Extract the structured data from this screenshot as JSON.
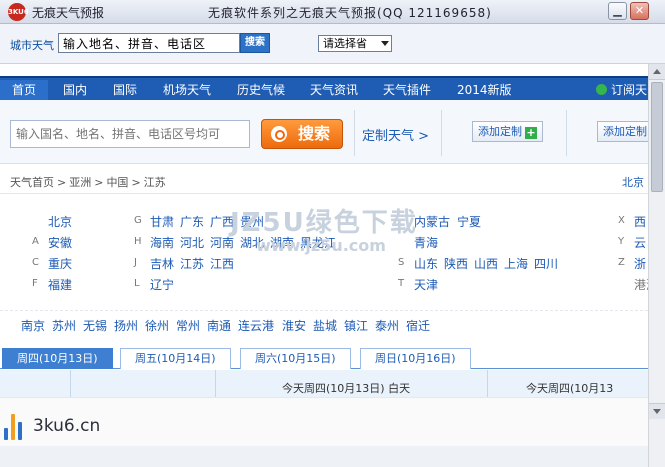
{
  "titlebar": {
    "logo_text": "3KU6",
    "app_name": "无痕天气预报",
    "window_title": "无痕软件系列之无痕天气预报(QQ 121169658)",
    "minimize": "▁",
    "close": "✕"
  },
  "toolbar": {
    "city_label": "城市天气",
    "input_value": "输入地名、拼音、电话区",
    "search_label": "搜索",
    "select_value": "请选择省"
  },
  "nav": {
    "items": [
      "首页",
      "国内",
      "国际",
      "机场天气",
      "历史气候",
      "天气资讯",
      "天气插件",
      "2014新版"
    ],
    "subscribe": "订阅天"
  },
  "site_search": {
    "placeholder": "输入国名、地名、拼音、电话区号均可",
    "button": "搜索",
    "custom_weather": "定制天气 >",
    "add_custom_1": "添加定制",
    "add_custom_2": "添加定制"
  },
  "breadcrumb": {
    "items": [
      "天气首页",
      "亚洲",
      "中国",
      "江苏"
    ],
    "separator": ">",
    "right": "北京"
  },
  "provinces": {
    "col1": [
      {
        "letter": "",
        "names": [
          "北京"
        ]
      },
      {
        "letter": "A",
        "names": [
          "安徽"
        ]
      },
      {
        "letter": "C",
        "names": [
          "重庆"
        ]
      },
      {
        "letter": "F",
        "names": [
          "福建"
        ]
      }
    ],
    "col2": [
      {
        "letter": "G",
        "names": [
          "甘肃",
          "广东",
          "广西",
          "贵州"
        ]
      },
      {
        "letter": "H",
        "names": [
          "海南",
          "河北",
          "河南",
          "湖北",
          "湖南",
          "黑龙江"
        ]
      },
      {
        "letter": "J",
        "names": [
          "吉林",
          "江苏",
          "江西"
        ]
      },
      {
        "letter": "L",
        "names": [
          "辽宁"
        ]
      }
    ],
    "col3": [
      {
        "letter": "",
        "names": [
          "内蒙古",
          "宁夏"
        ]
      },
      {
        "letter": "",
        "names": [
          "青海"
        ]
      },
      {
        "letter": "S",
        "names": [
          "山东",
          "陕西",
          "山西",
          "上海",
          "四川"
        ]
      },
      {
        "letter": "T",
        "names": [
          "天津"
        ]
      }
    ],
    "col4": [
      {
        "letter": "X",
        "names": [
          "西"
        ]
      },
      {
        "letter": "Y",
        "names": [
          "云"
        ]
      },
      {
        "letter": "Z",
        "names": [
          "浙"
        ]
      },
      {
        "letter": "",
        "names": [
          "港澳台"
        ]
      }
    ]
  },
  "cities": [
    "南京",
    "苏州",
    "无锡",
    "扬州",
    "徐州",
    "常州",
    "南通",
    "连云港",
    "淮安",
    "盐城",
    "镇江",
    "泰州",
    "宿迁"
  ],
  "day_tabs": [
    "周四(10月13日)",
    "周五(10月14日)",
    "周六(10月15日)",
    "周日(10月16日)"
  ],
  "forecast": {
    "day_label_1": "今天周四(10月13日) 白天",
    "day_label_2": "今天周四(10月13"
  },
  "watermark": {
    "big": "JZ5U绿色下载",
    "small": "www.jz5u.com"
  },
  "banner": {
    "text": "3ku6.cn",
    "bar_colors": [
      "#2f6fc7",
      "#f0a020",
      "#2f6fc7"
    ]
  },
  "colors": {
    "nav_blue": "#1e5db3",
    "link_blue": "#1d5bb5",
    "search_orange": "#ee6a0e",
    "add_green": "#2fae4a"
  }
}
